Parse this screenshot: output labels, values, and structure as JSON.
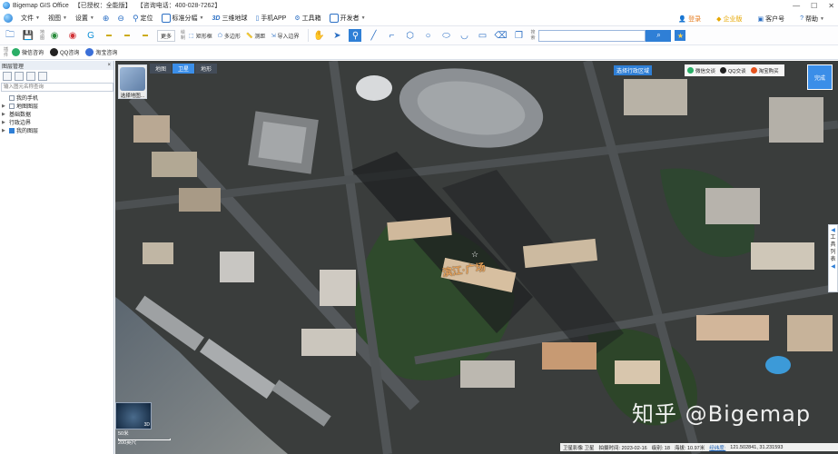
{
  "title_bar": {
    "app": "Bigemap GIS Office",
    "license": "【已授权：全能版】",
    "phone": "【咨询电话：400-028-7262】",
    "minimize_icon": "minimize-icon",
    "maximize_icon": "maximize-icon",
    "close_icon": "close-icon"
  },
  "menu": {
    "file": "文件",
    "view": "视图",
    "settings": "设置",
    "locate": "定位",
    "standard_tiles": "标准分幅",
    "three_d": "三维地球",
    "mobile_app": "手机APP",
    "toolbox": "工具箱",
    "dev": "开发者",
    "login": "登录",
    "enterprise": "企业版",
    "customer": "客户号",
    "help": "帮助"
  },
  "toolbar": {
    "group_label": "地图",
    "more": "更多",
    "draw_group": "绘制",
    "rect": "矩形框",
    "polygon": "多边形",
    "measure": "测距",
    "import_border": "导入边界",
    "search_group": "搜索",
    "search_placeholder": ""
  },
  "plugins": {
    "group_label": "插件",
    "wechat": "微信咨询",
    "qq": "QQ咨询",
    "taobao": "淘宝咨询"
  },
  "layers_panel": {
    "title": "图层管理",
    "close": "×",
    "search_placeholder": "输入图元名称查询",
    "items": [
      {
        "label": "我的手机",
        "checked": false
      },
      {
        "label": "地图图层",
        "checked": false
      },
      {
        "label": "基础数据",
        "checked": false
      },
      {
        "label": "行政边界",
        "checked": false
      },
      {
        "label": "我的图层",
        "checked": true
      }
    ]
  },
  "map": {
    "tabs": [
      "地图",
      "卫星",
      "地形"
    ],
    "active_tab": "卫星",
    "layer_picker": "选择地图...",
    "select_region": "选择行政区域",
    "contact": {
      "wechat": "微信交谈",
      "qq": "QQ交谈",
      "taobao": "淘宝购买"
    },
    "done": "完成",
    "side_tab": [
      "工",
      "具",
      "列",
      "表"
    ],
    "globe_3d": "3D",
    "scale_top": "50米",
    "scale_bottom": "200英尺",
    "watermark": "知乎 @Bigemap",
    "label": "滨江·广场"
  },
  "status": {
    "source": "卫星影像 卫星",
    "shot_time": "拍摄时间: 2023-02-16",
    "level": "级别: 18",
    "altitude": "海拔: 10.97米",
    "lnglat_label": "经纬度:",
    "coords": "121.502841, 31.231593"
  }
}
